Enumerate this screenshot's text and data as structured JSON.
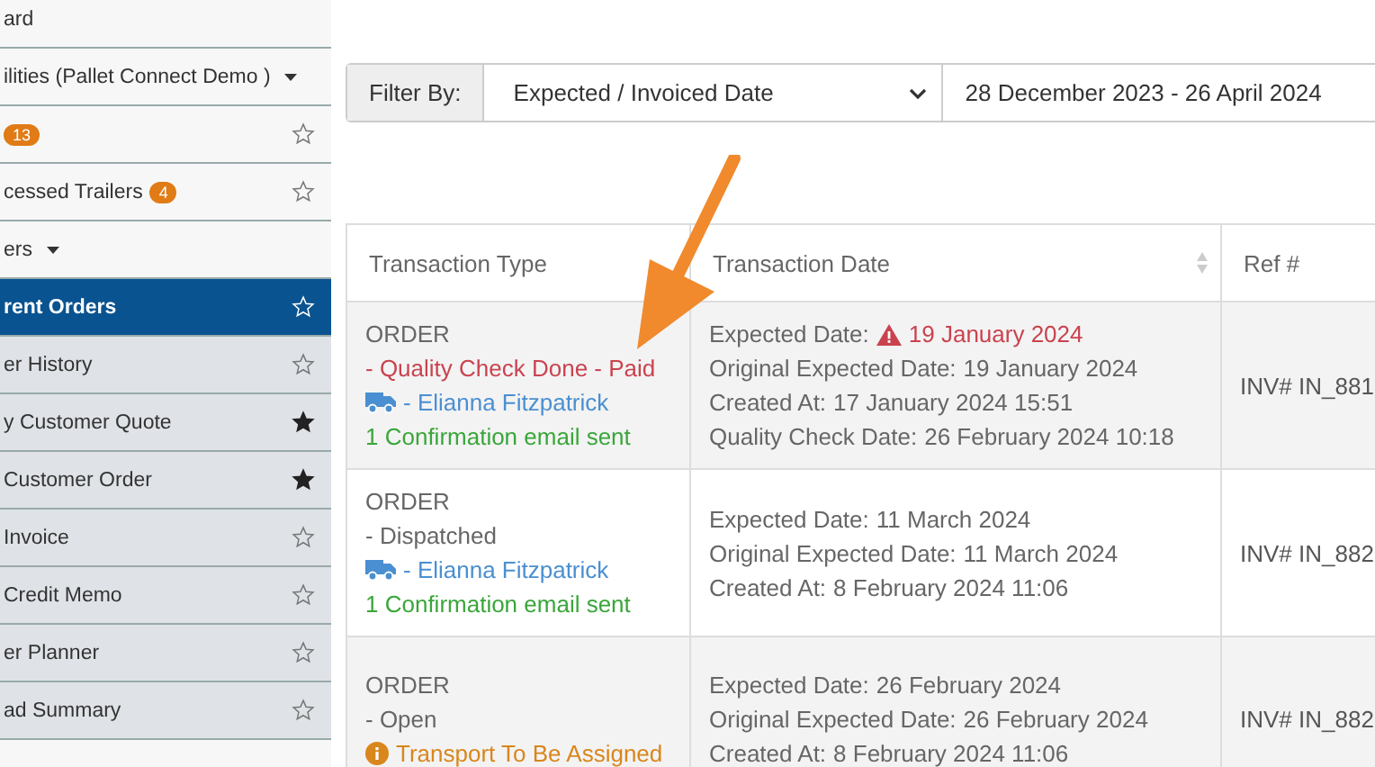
{
  "sidebar": {
    "items": [
      {
        "kind": "link",
        "label": "ard"
      },
      {
        "kind": "group",
        "label": "ilities (Pallet Connect Demo )"
      },
      {
        "kind": "link",
        "badge": "13",
        "starred": false
      },
      {
        "kind": "link",
        "label": "cessed Trailers",
        "badge": "4",
        "starred": false
      },
      {
        "kind": "group",
        "label": "ers"
      },
      {
        "kind": "sub",
        "label": "rent Orders",
        "starred": false,
        "selected": true
      },
      {
        "kind": "sub",
        "label": "er History",
        "starred": false,
        "selected": false
      },
      {
        "kind": "sub",
        "label": "y Customer Quote",
        "starred": true,
        "selected": false
      },
      {
        "kind": "sub",
        "label": " Customer Order",
        "starred": true,
        "selected": false
      },
      {
        "kind": "sub",
        "label": " Invoice",
        "starred": false,
        "selected": false
      },
      {
        "kind": "sub",
        "label": " Credit Memo",
        "starred": false,
        "selected": false
      },
      {
        "kind": "sub",
        "label": "er Planner",
        "starred": false,
        "selected": false
      },
      {
        "kind": "sub",
        "label": "ad Summary",
        "starred": false,
        "selected": false
      }
    ]
  },
  "filter": {
    "label": "Filter By:",
    "field": "Expected / Invoiced Date",
    "date_range": "28 December 2023 - 26 April 2024"
  },
  "table": {
    "columns": [
      "Transaction Type",
      "Transaction Date",
      "Ref #"
    ],
    "rows": [
      {
        "type_lines": [
          {
            "kind": "plain",
            "text": "ORDER"
          },
          {
            "kind": "alert",
            "text": "- Quality Check Done - Paid"
          },
          {
            "kind": "driver",
            "text": "- Elianna Fitzpatrick"
          },
          {
            "kind": "success",
            "text": "1 Confirmation email sent"
          }
        ],
        "date_lines": [
          {
            "label": "Expected Date:",
            "value": "19 January 2024",
            "overdue": true
          },
          {
            "label": "Original Expected Date:",
            "value": "19 January 2024",
            "overdue": false
          },
          {
            "label": "Created At:",
            "value": "17 January 2024 15:51",
            "overdue": false
          },
          {
            "label": "Quality Check Date:",
            "value": "26 February 2024 10:18",
            "overdue": false
          }
        ],
        "ref": "INV# IN_881"
      },
      {
        "type_lines": [
          {
            "kind": "plain",
            "text": "ORDER"
          },
          {
            "kind": "plain",
            "text": "- Dispatched"
          },
          {
            "kind": "driver",
            "text": "- Elianna Fitzpatrick"
          },
          {
            "kind": "success",
            "text": "1 Confirmation email sent"
          }
        ],
        "date_lines": [
          {
            "label": "Expected Date:",
            "value": "11 March 2024",
            "overdue": false
          },
          {
            "label": "Original Expected Date:",
            "value": "11 March 2024",
            "overdue": false
          },
          {
            "label": "Created At:",
            "value": "8 February 2024 11:06",
            "overdue": false
          }
        ],
        "ref": "INV# IN_882"
      },
      {
        "type_lines": [
          {
            "kind": "plain",
            "text": "ORDER"
          },
          {
            "kind": "plain",
            "text": "- Open"
          },
          {
            "kind": "warning",
            "text": "Transport To Be Assigned"
          }
        ],
        "date_lines": [
          {
            "label": "Expected Date:",
            "value": "26 February 2024",
            "overdue": false
          },
          {
            "label": "Original Expected Date:",
            "value": "26 February 2024",
            "overdue": false
          },
          {
            "label": "Created At:",
            "value": "8 February 2024 11:06",
            "overdue": false
          }
        ],
        "ref": "INV# IN_882"
      }
    ]
  }
}
